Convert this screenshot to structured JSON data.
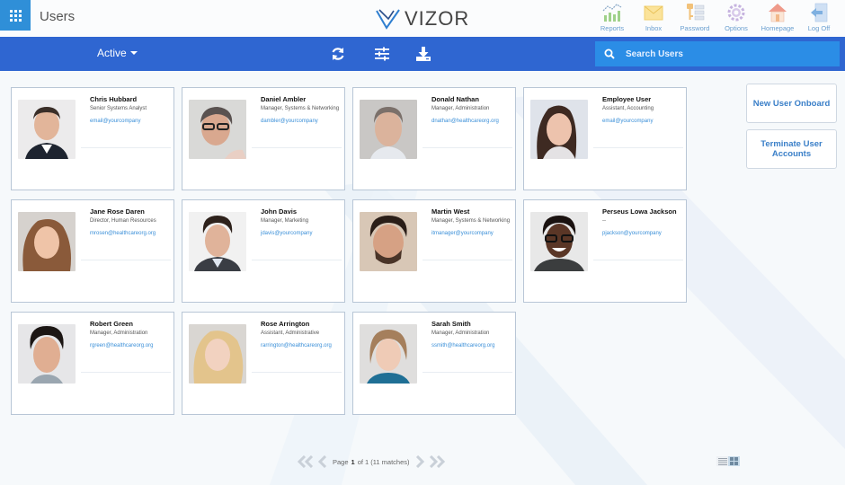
{
  "header": {
    "title": "Users",
    "logo_text": "VIZOR",
    "nav": [
      {
        "label": "Reports",
        "icon": "reports-chart-icon"
      },
      {
        "label": "Inbox",
        "icon": "envelope-icon"
      },
      {
        "label": "Password",
        "icon": "key-icon"
      },
      {
        "label": "Options",
        "icon": "gear-icon"
      },
      {
        "label": "Homepage",
        "icon": "house-icon"
      },
      {
        "label": "Log Off",
        "icon": "logoff-arrow-icon"
      }
    ]
  },
  "toolbar": {
    "status_filter": "Active",
    "search_placeholder": "Search Users",
    "actions": [
      "refresh-icon",
      "filter-sliders-icon",
      "download-icon"
    ]
  },
  "users": [
    {
      "name": "Chris Hubbard",
      "role": "Senior Systems Analyst",
      "email": "email@yourcompany"
    },
    {
      "name": "Daniel Ambler",
      "role": "Manager, Systems & Networking",
      "email": "dambler@yourcompany"
    },
    {
      "name": "Donald Nathan",
      "role": "Manager, Administration",
      "email": "dnathan@healthcareorg.org"
    },
    {
      "name": "Employee User",
      "role": "Assistant, Accounting",
      "email": "email@yourcompany"
    },
    {
      "name": "Jane Rose Daren",
      "role": "Director, Human Resources",
      "email": "mrosen@healthcareorg.org"
    },
    {
      "name": "John Davis",
      "role": "Manager, Marketing",
      "email": "jdavis@yourcompany"
    },
    {
      "name": "Martin West",
      "role": "Manager, Systems & Networking",
      "email": "itmanager@yourcompany"
    },
    {
      "name": "Perseus Lowa Jackson",
      "role": "--",
      "email": "pjackson@yourcompany"
    },
    {
      "name": "Robert Green",
      "role": "Manager, Administration",
      "email": "rgreen@healthcareorg.org"
    },
    {
      "name": "Rose Arrington",
      "role": "Assistant, Administrative",
      "email": "rarrington@healthcareorg.org"
    },
    {
      "name": "Sarah Smith",
      "role": "Manager, Administration",
      "email": "ssmith@healthcareorg.org"
    }
  ],
  "side_actions": {
    "new_user": "New User Onboard",
    "terminate": "Terminate User Accounts"
  },
  "pager": {
    "page_label": "Page",
    "current_page": "1",
    "of_text": "of 1 (11 matches)"
  },
  "view_mode": "grid",
  "colors": {
    "toolbar": "#2f66d1",
    "search": "#2b8de6",
    "accent": "#3a8fd8"
  }
}
